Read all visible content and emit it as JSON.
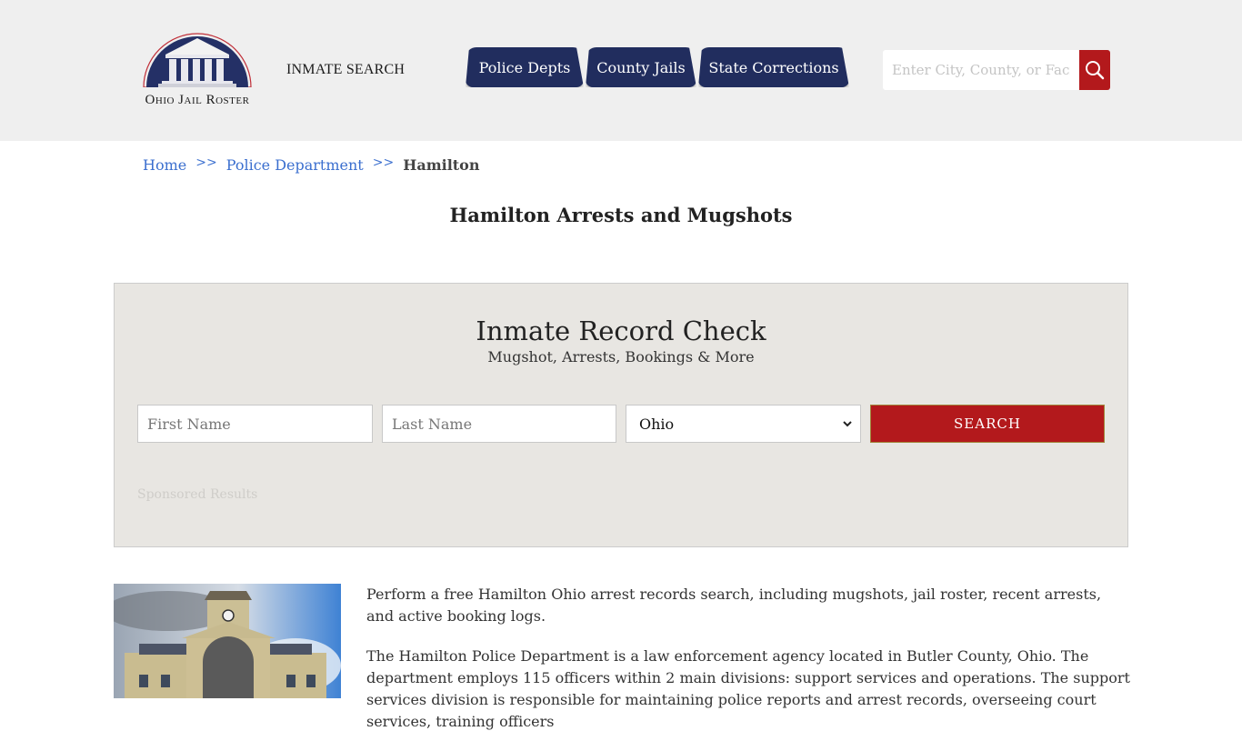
{
  "header": {
    "logo_text": "Ohio Jail Roster",
    "inmate_search_label": "INMATE SEARCH",
    "nav_tabs": [
      {
        "label": "Police Depts"
      },
      {
        "label": "County Jails"
      },
      {
        "label": "State Corrections"
      }
    ],
    "search": {
      "placeholder": "Enter City, County, or Facility",
      "button_icon": "search-icon"
    }
  },
  "breadcrumb": {
    "items": [
      {
        "label": "Home"
      },
      {
        "label": "Police Department"
      },
      {
        "label": "Hamilton"
      }
    ],
    "separator": ">>"
  },
  "page_title": "Hamilton Arrests and Mugshots",
  "record_check": {
    "title": "Inmate Record Check",
    "subtitle": "Mugshot, Arrests, Bookings & More",
    "first_name_placeholder": "First Name",
    "last_name_placeholder": "Last Name",
    "state_selected": "Ohio",
    "search_label": "SEARCH",
    "sponsored_label": "Sponsored Results"
  },
  "content": {
    "paragraphs": [
      "Perform a free Hamilton Ohio arrest records search, including mugshots, jail roster, recent arrests, and active booking logs.",
      "The Hamilton Police Department is a law enforcement agency located in Butler County, Ohio. The department employs 115 officers within 2 main divisions: support services and operations. The support services division is responsible for maintaining police reports and arrest records, overseeing court services, training officers"
    ]
  },
  "colors": {
    "nav_bg": "#212d5e",
    "accent_red": "#b3191c",
    "link_blue": "#3b6fcf",
    "header_bg": "#efefef",
    "panel_bg": "#e8e6e2"
  }
}
